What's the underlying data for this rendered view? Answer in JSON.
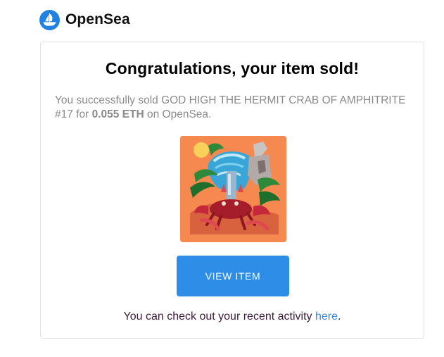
{
  "brand": {
    "name": "OpenSea",
    "logo_icon": "opensea-boat-icon",
    "accent_color": "#2081e2"
  },
  "email": {
    "title": "Congratulations, your item sold!",
    "description_prefix": "You successfully sold GOD HIGH THE HERMIT CRAB OF AMPHITRITE #17 for ",
    "price": "0.055 ETH",
    "description_suffix": " on OpenSea.",
    "item_image": "hermit-crab-nft-image",
    "view_button_label": "VIEW ITEM",
    "button_color": "#2e8de6",
    "footer_prefix": "You can check out your recent activity ",
    "footer_link": "here",
    "footer_suffix": "."
  }
}
